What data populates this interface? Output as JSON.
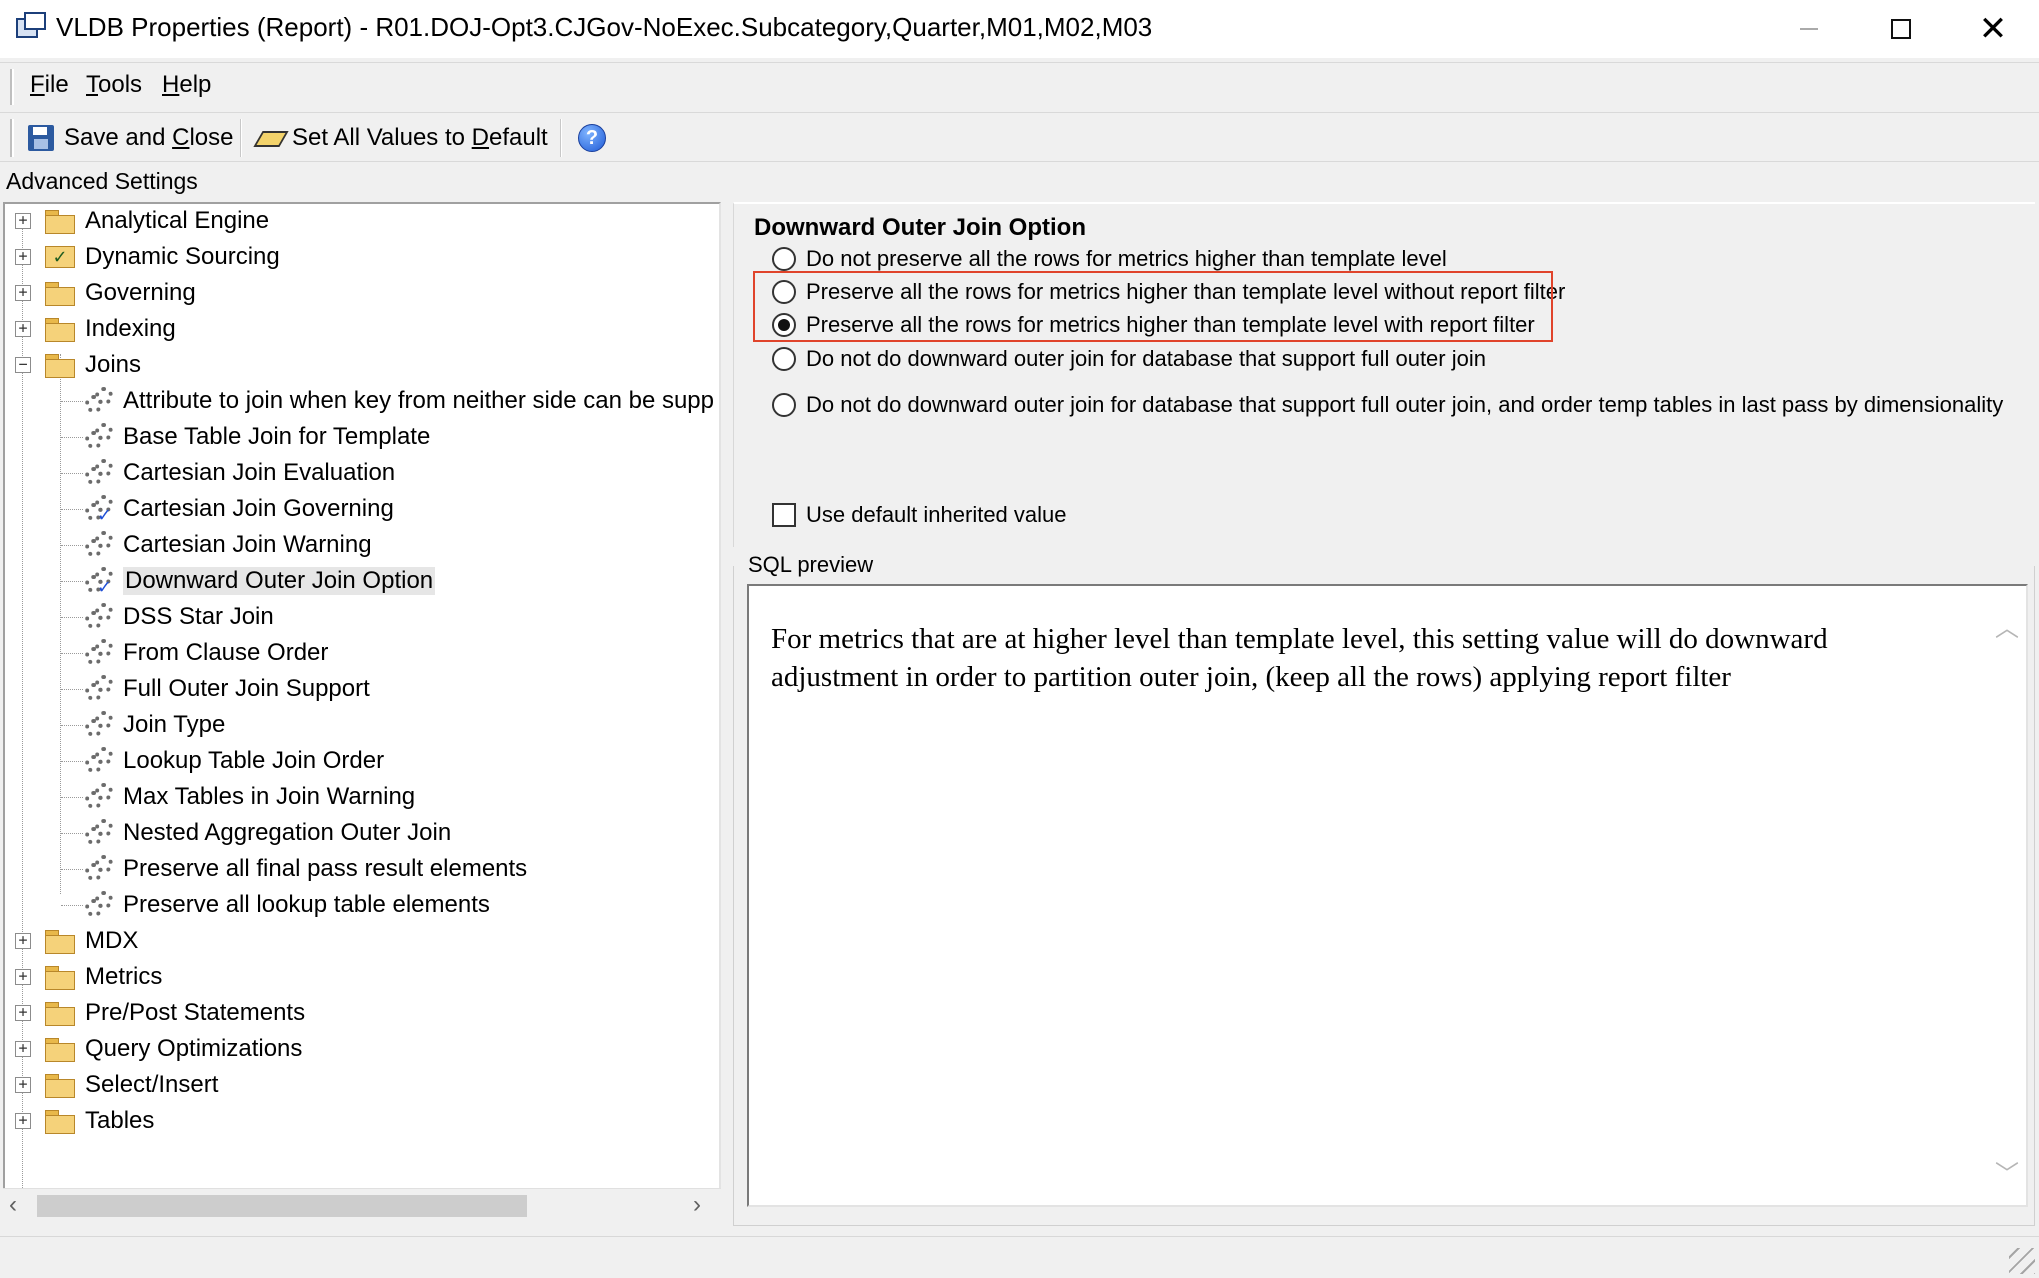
{
  "window": {
    "title": "VLDB Properties (Report) - R01.DOJ-Opt3.CJGov-NoExec.Subcategory,Quarter,M01,M02,M03"
  },
  "menu": [
    {
      "label": "File",
      "key": "F",
      "rest": "ile"
    },
    {
      "label": "Tools",
      "key": "T",
      "rest": "ools"
    },
    {
      "label": "Help",
      "key": "H",
      "rest": "elp"
    }
  ],
  "toolbar": {
    "save_close_pre": "Save and ",
    "save_close_key": "C",
    "save_close_post": "lose",
    "set_default_pre": "Set All Values to ",
    "set_default_key": "D",
    "set_default_post": "efault",
    "help_glyph": "?"
  },
  "advanced_settings_label": "Advanced Settings",
  "tree": {
    "top_folders_before": [
      {
        "label": "Analytical Engine",
        "icon": "folder"
      },
      {
        "label": "Dynamic Sourcing",
        "icon": "checked-folder"
      },
      {
        "label": "Governing",
        "icon": "folder"
      },
      {
        "label": "Indexing",
        "icon": "folder"
      }
    ],
    "joins": {
      "label": "Joins",
      "children": [
        {
          "label": "Attribute to join when key from neither side can be supp",
          "modified": false
        },
        {
          "label": "Base Table Join for Template",
          "modified": false
        },
        {
          "label": "Cartesian Join Evaluation",
          "modified": false
        },
        {
          "label": "Cartesian Join Governing",
          "modified": true
        },
        {
          "label": "Cartesian Join Warning",
          "modified": false
        },
        {
          "label": "Downward Outer Join Option",
          "modified": true,
          "selected": true
        },
        {
          "label": "DSS Star Join",
          "modified": false
        },
        {
          "label": "From Clause Order",
          "modified": false
        },
        {
          "label": "Full Outer Join Support",
          "modified": false
        },
        {
          "label": "Join Type",
          "modified": false
        },
        {
          "label": "Lookup Table Join Order",
          "modified": false
        },
        {
          "label": "Max Tables in Join Warning",
          "modified": false
        },
        {
          "label": "Nested Aggregation Outer Join",
          "modified": false
        },
        {
          "label": "Preserve all final pass result elements",
          "modified": false
        },
        {
          "label": "Preserve all lookup table elements",
          "modified": false
        }
      ]
    },
    "top_folders_after": [
      {
        "label": "MDX"
      },
      {
        "label": "Metrics"
      },
      {
        "label": "Pre/Post Statements"
      },
      {
        "label": "Query Optimizations"
      },
      {
        "label": "Select/Insert"
      },
      {
        "label": "Tables"
      }
    ]
  },
  "option": {
    "title": "Downward Outer Join Option",
    "choices": [
      {
        "label": "Do not preserve all the rows for metrics higher than template level",
        "checked": false
      },
      {
        "label": "Preserve all the rows for metrics higher than template level without report filter",
        "checked": false
      },
      {
        "label": "Preserve all the rows for metrics higher than template level with report filter",
        "checked": true
      },
      {
        "label": "Do not do downward outer join for database that support full outer join",
        "checked": false
      },
      {
        "label": "Do not do downward outer join for database that support full outer join, and order temp tables in last pass by dimensionality",
        "checked": false
      }
    ],
    "use_default_label": "Use default inherited value",
    "use_default_checked": false,
    "highlight_color": "#e0442b"
  },
  "sql_preview": {
    "label": "SQL preview",
    "text": "For metrics that are at higher level than template level, this setting value will do downward adjustment in order to partition outer join, (keep all the rows) applying report filter"
  }
}
